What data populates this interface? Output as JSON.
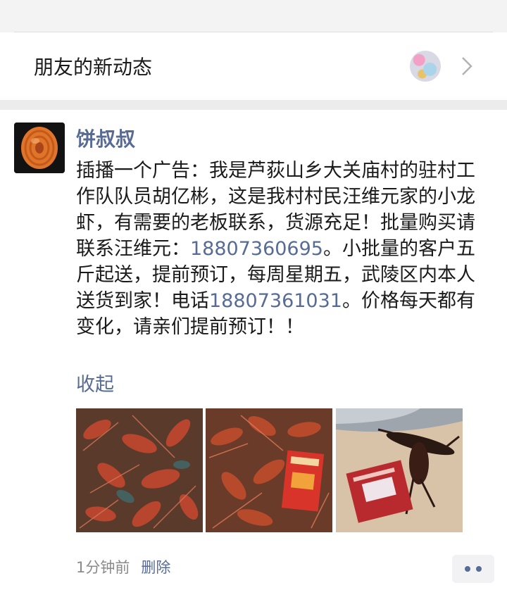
{
  "friends_updates": {
    "title": "朋友的新动态"
  },
  "post": {
    "username": "饼叔叔",
    "content_part1": "插播一个广告：我是芦荻山乡大关庙村的驻村工作队队员胡亿彬，这是我村村民汪维元家的小龙虾，有需要的老板联系，货源充足！批量购买请联系汪维元：",
    "phone1": "18807360695",
    "content_part2": "。小批量的客户五斤起送，提前预订，每周星期五，武陵区内本人送货到家！电话",
    "phone2": "18807361031",
    "content_part3": "。价格每天都有变化，请亲们提前预订！！",
    "collapse_label": "收起",
    "time": "1分钟前",
    "delete_label": "删除",
    "image_label_1": "",
    "image_label_2": "",
    "image_label_3": ""
  },
  "colors": {
    "link": "#576b95",
    "meta": "#8a8a8a"
  },
  "icons": {
    "chevron": "chevron-right-icon",
    "more": "more-dots-icon"
  }
}
